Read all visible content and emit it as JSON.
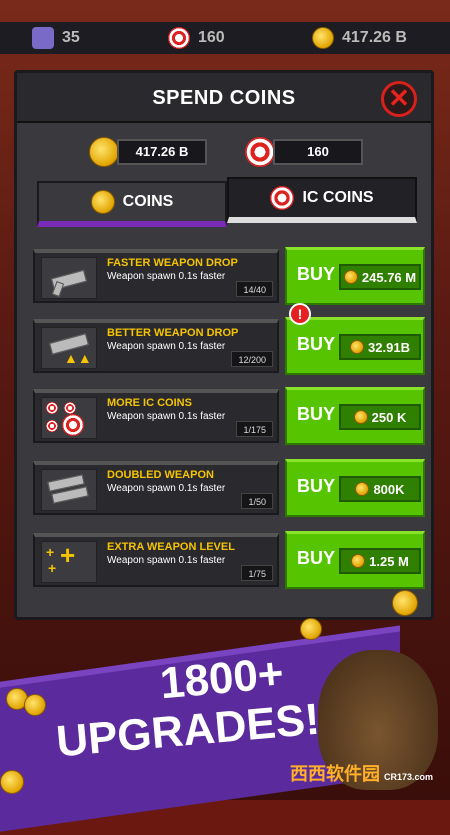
{
  "topbar": {
    "gems": "35",
    "ic_coins": "160",
    "coins": "417.26 B"
  },
  "dialog": {
    "title": "SPEND COINS",
    "close_icon": "close-x-icon",
    "balance_coins": "417.26 B",
    "balance_ic": "160",
    "tabs": [
      {
        "label": "COINS",
        "icon": "coin-icon",
        "active": true
      },
      {
        "label": "IC COINS",
        "icon": "target-icon",
        "active": false
      }
    ],
    "upgrades": [
      {
        "name": "FASTER WEAPON DROP",
        "desc": "Weapon spawn 0.1s faster",
        "progress": "14/40",
        "buy": "BUY",
        "price": "245.76 M"
      },
      {
        "name": "BETTER WEAPON DROP",
        "desc": "Weapon spawn 0.1s faster",
        "progress": "12/200",
        "buy": "BUY",
        "price": "32.91B",
        "alert": "!"
      },
      {
        "name": "MORE IC COINS",
        "desc": "Weapon spawn 0.1s faster",
        "progress": "1/175",
        "buy": "BUY",
        "price": "250 K"
      },
      {
        "name": "DOUBLED WEAPON",
        "desc": "Weapon spawn 0.1s faster",
        "progress": "1/50",
        "buy": "BUY",
        "price": "800K"
      },
      {
        "name": "EXTRA WEAPON LEVEL",
        "desc": "Weapon spawn 0.1s faster",
        "progress": "1/75",
        "buy": "BUY",
        "price": "1.25 M"
      }
    ]
  },
  "promo": {
    "line1": "1800+",
    "line2": "UPGRADES!"
  },
  "watermark": {
    "brand": "西西",
    "sub": "软件园",
    "url": "CR173.com"
  }
}
